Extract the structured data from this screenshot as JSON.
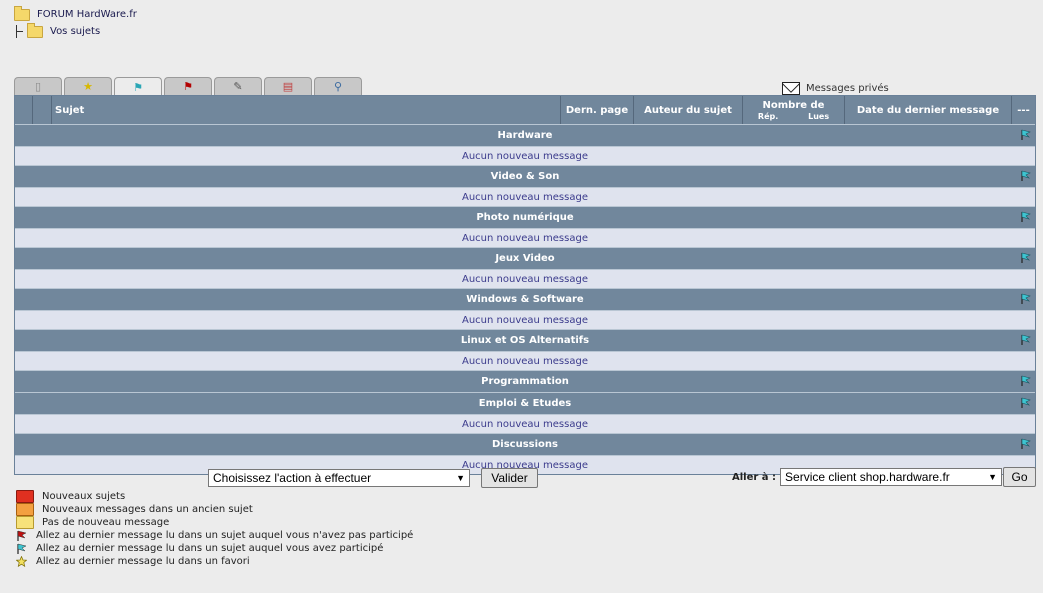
{
  "breadcrumb": {
    "forum": "FORUM HardWare.fr",
    "section": "Vos sujets"
  },
  "tabs": [
    {
      "icon": "page-icon",
      "glyph": "▯",
      "color": "#8a8a8a"
    },
    {
      "icon": "stars-icon",
      "glyph": "★",
      "color": "#d8b800"
    },
    {
      "icon": "cyan-flag-icon",
      "glyph": "⚑",
      "color": "#2aa6b5",
      "active": true
    },
    {
      "icon": "red-flag-icon",
      "glyph": "⚑",
      "color": "#b30000"
    },
    {
      "icon": "tools-icon",
      "glyph": "✎",
      "color": "#555555"
    },
    {
      "icon": "document-icon",
      "glyph": "▤",
      "color": "#c04040"
    },
    {
      "icon": "magnifier-icon",
      "glyph": "⚲",
      "color": "#3a6aa0"
    }
  ],
  "private_messages": "Messages privés",
  "table": {
    "headers": {
      "sujet": "Sujet",
      "dern_page": "Dern. page",
      "auteur": "Auteur du sujet",
      "nombre": "Nombre de",
      "rep": "Rép.",
      "lues": "Lues",
      "date": "Date du dernier message",
      "last": "---"
    },
    "categories": [
      {
        "name": "Hardware",
        "message": "Aucun nouveau message"
      },
      {
        "name": "Video & Son",
        "message": "Aucun nouveau message"
      },
      {
        "name": "Photo numérique",
        "message": "Aucun nouveau message"
      },
      {
        "name": "Jeux Video",
        "message": "Aucun nouveau message"
      },
      {
        "name": "Windows & Software",
        "message": "Aucun nouveau message"
      },
      {
        "name": "Linux et OS Alternatifs",
        "message": "Aucun nouveau message"
      },
      {
        "name": "Programmation",
        "message": null
      },
      {
        "name": "Emploi & Etudes",
        "message": "Aucun nouveau message"
      },
      {
        "name": "Discussions",
        "message": "Aucun nouveau message"
      }
    ]
  },
  "actions": {
    "select_value": "Choisissez l'action à effectuer",
    "valider": "Valider"
  },
  "goto": {
    "label": "Aller à :",
    "select_value": "Service client shop.hardware.fr",
    "go": "Go"
  },
  "legend": [
    {
      "icon": "red-folder-icon",
      "text": "Nouveaux sujets"
    },
    {
      "icon": "orange-folder-icon",
      "text": "Nouveaux messages dans un ancien sujet"
    },
    {
      "icon": "yellow-folder-icon",
      "text": "Pas de nouveau message"
    },
    {
      "icon": "red-flag-icon",
      "text": "Allez au dernier message lu dans un sujet auquel vous n'avez pas participé"
    },
    {
      "icon": "cyan-flag-icon",
      "text": "Allez au dernier message lu dans un sujet auquel vous avez participé"
    },
    {
      "icon": "star-icon",
      "text": "Allez au dernier message lu dans un favori"
    }
  ],
  "colors": {
    "header_bg": "#71879c",
    "message_row_bg": "#dfe3ee",
    "message_text": "#3b3b8c",
    "page_bg": "#ececec"
  }
}
